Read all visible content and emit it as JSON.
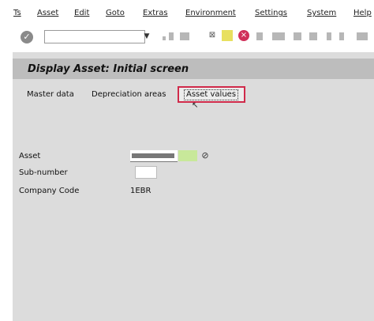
{
  "menubar": {
    "items": [
      {
        "label": "Ts"
      },
      {
        "label": "Asset"
      },
      {
        "label": "Edit"
      },
      {
        "label": "Goto"
      },
      {
        "label": "Extras"
      },
      {
        "label": "Environment"
      },
      {
        "label": "Settings"
      },
      {
        "label": "System"
      },
      {
        "label": "Help"
      }
    ]
  },
  "toolbar": {
    "command_value": "",
    "icons": [
      "check-icon",
      "save-icon",
      "back-icon",
      "exit-icon",
      "cancel-icon",
      "print-icon",
      "find-icon",
      "layout-icon",
      "help-icon"
    ]
  },
  "screen": {
    "title": "Display Asset: Initial screen"
  },
  "tabs": [
    {
      "label": "Master data"
    },
    {
      "label": "Depreciation areas"
    },
    {
      "label": "Asset values"
    }
  ],
  "fields": {
    "asset_label": "Asset",
    "subnumber_label": "Sub-number",
    "company_code_label": "Company Code",
    "asset_value": "",
    "subnumber_value": "",
    "company_code_value": "1EBR"
  },
  "colors": {
    "title_bar": "#bdbdbd",
    "main_bg": "#dcdcdc",
    "highlight_border": "#d02a4a",
    "asset_input_green": "#c8e89a"
  }
}
